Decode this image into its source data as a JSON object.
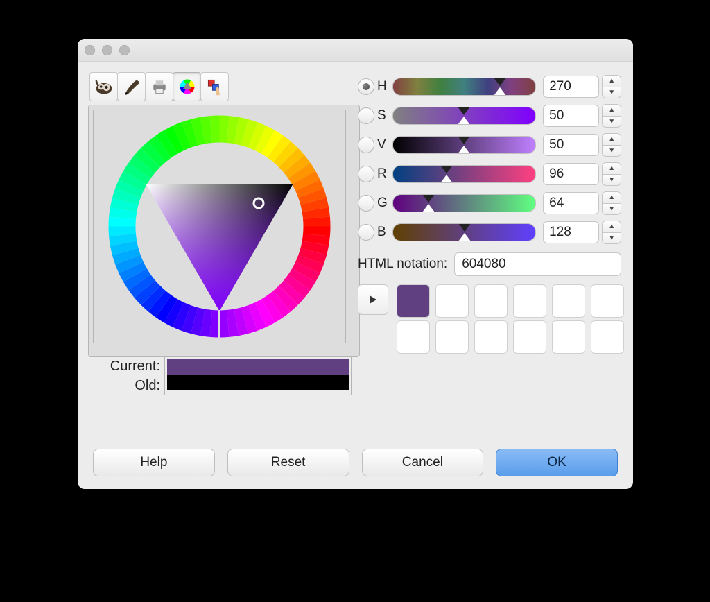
{
  "tabs": {
    "gimp_tooltip": "GIMP",
    "brush_tooltip": "Palettes",
    "print_tooltip": "Print",
    "wheel_tooltip": "Color Wheel",
    "picker_tooltip": "Picker"
  },
  "channels": {
    "H": {
      "label": "H",
      "value": "270",
      "selected": true,
      "pos": 0.75
    },
    "S": {
      "label": "S",
      "value": "50",
      "selected": false,
      "pos": 0.5
    },
    "V": {
      "label": "V",
      "value": "50",
      "selected": false,
      "pos": 0.5
    },
    "R": {
      "label": "R",
      "value": "96",
      "selected": false,
      "pos": 0.376
    },
    "G": {
      "label": "G",
      "value": "64",
      "selected": false,
      "pos": 0.251
    },
    "B": {
      "label": "B",
      "value": "128",
      "selected": false,
      "pos": 0.502
    }
  },
  "notation": {
    "label": "HTML notation:",
    "value": "604080"
  },
  "current_label": "Current:",
  "old_label": "Old:",
  "current_color": "#604080",
  "old_color": "#000000",
  "swatches": [
    "#604080",
    "#FFFFFF",
    "#FFFFFF",
    "#FFFFFF",
    "#FFFFFF",
    "#FFFFFF",
    "#FFFFFF",
    "#FFFFFF",
    "#FFFFFF",
    "#FFFFFF",
    "#FFFFFF",
    "#FFFFFF"
  ],
  "buttons": {
    "help": "Help",
    "reset": "Reset",
    "cancel": "Cancel",
    "ok": "OK"
  }
}
